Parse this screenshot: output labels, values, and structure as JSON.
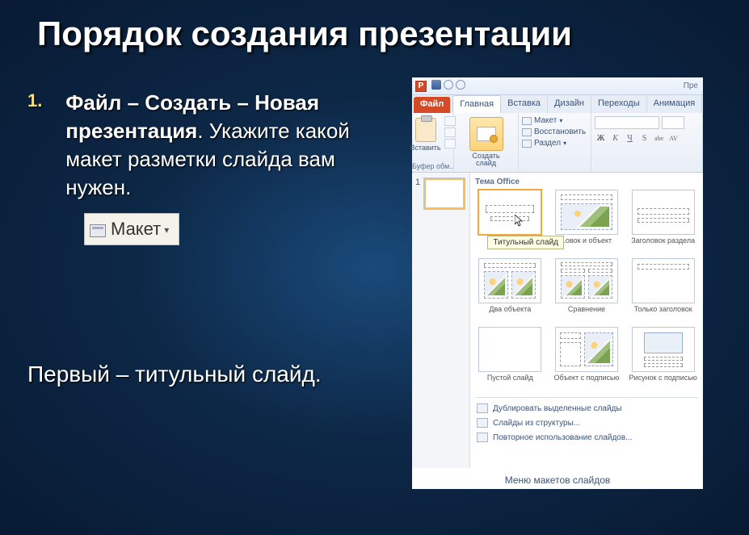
{
  "title": "Порядок создания презентации",
  "list_marker": "1.",
  "step_bold": "Файл – Создать – Новая презентация",
  "step_rest": ". Укажите какой макет разметки слайда вам нужен.",
  "maket_label": "Макет",
  "para2": "Первый – титульный слайд.",
  "pp": {
    "p_letter": "P",
    "corner_title": "Пре",
    "tabs": {
      "file": "Файл",
      "home": "Главная",
      "insert": "Вставка",
      "design": "Дизайн",
      "transitions": "Переходы",
      "anim": "Анимация"
    },
    "ribbon": {
      "clipboard": {
        "paste": "Вставить",
        "group": "Буфер обм..."
      },
      "slides": {
        "new_slide": "Создать\nслайд",
        "layout": "Макет",
        "reset": "Восстановить",
        "section": "Раздел"
      },
      "font": {
        "bold": "Ж",
        "italic": "К",
        "underline": "Ч",
        "strike": "S",
        "shadow": "abe",
        "spacing": "AV"
      }
    },
    "thumb_num": "1",
    "gallery": {
      "header": "Тема Office",
      "tooltip": "Титульный слайд",
      "items": [
        {
          "label": "Титульн.."
        },
        {
          "label": "..овок и объект"
        },
        {
          "label": "Заголовок раздела"
        },
        {
          "label": "Два объекта"
        },
        {
          "label": "Сравнение"
        },
        {
          "label": "Только заголовок"
        },
        {
          "label": "Пустой слайд"
        },
        {
          "label": "Объект с подписью"
        },
        {
          "label": "Рисунок с подписью"
        }
      ],
      "menu": {
        "dup": "Дублировать выделенные слайды",
        "outline": "Слайды из структуры...",
        "reuse": "Повторное использование слайдов..."
      }
    },
    "caption": "Меню макетов слайдов"
  }
}
